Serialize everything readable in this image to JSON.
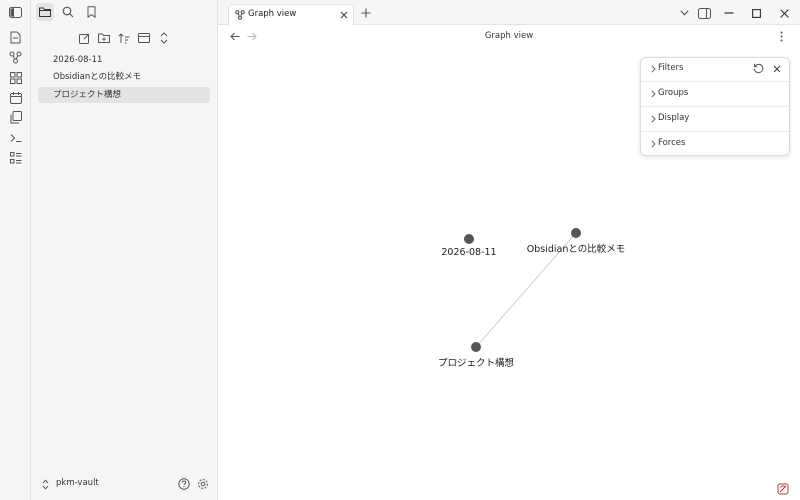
{
  "ribbon": {
    "icons": [
      "toggle-sidebar-icon",
      "new-note-icon",
      "graph-icon",
      "canvas-icon",
      "daily-note-icon",
      "templates-icon",
      "command-palette-icon",
      "bases-icon"
    ]
  },
  "sidebar": {
    "top_icons": [
      "folder-icon",
      "search-icon",
      "bookmark-icon"
    ],
    "nav_icons": [
      "new-note-icon",
      "new-folder-icon",
      "sort-icon",
      "collapse-icon",
      "expand-icon"
    ],
    "files": [
      {
        "label": "2026-08-11"
      },
      {
        "label": "Obsidianとの比較メモ"
      },
      {
        "label": "プロジェクト構想"
      }
    ],
    "vault_name": "pkm-vault"
  },
  "tabbar": {
    "tab_title": "Graph view"
  },
  "view": {
    "title": "Graph view"
  },
  "graph": {
    "nodes": [
      {
        "label": "2026-08-11"
      },
      {
        "label": "Obsidianとの比較メモ"
      },
      {
        "label": "プロジェクト構想"
      }
    ],
    "edges": [
      [
        "Obsidianとの比較メモ",
        "プロジェクト構想"
      ]
    ],
    "node_color": "#555555",
    "edge_color": "#cfcfcf"
  },
  "panel": {
    "sections": [
      {
        "label": "Filters"
      },
      {
        "label": "Groups"
      },
      {
        "label": "Display"
      },
      {
        "label": "Forces"
      }
    ]
  },
  "colors": {
    "sidebar_bg": "#f6f6f6",
    "active_item_bg": "#e4e4e4",
    "accent_red": "#c0392b"
  }
}
